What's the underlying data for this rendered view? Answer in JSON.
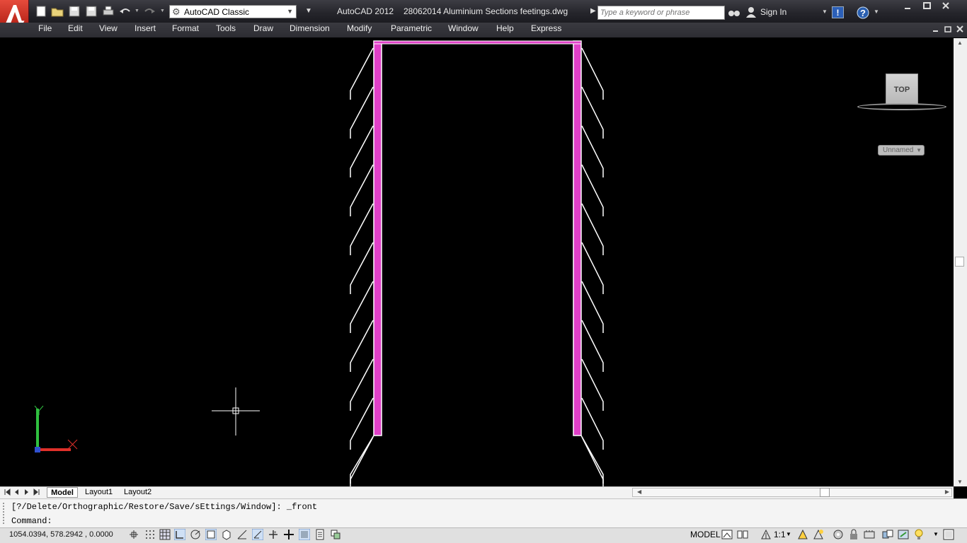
{
  "titlebar": {
    "workspace": "AutoCAD Classic",
    "app_name": "AutoCAD 2012",
    "file_name": "28062014 Aluminium Sections feetings.dwg",
    "search_placeholder": "Type a keyword or phrase",
    "sign_in": "Sign In"
  },
  "menu": [
    "File",
    "Edit",
    "View",
    "Insert",
    "Format",
    "Tools",
    "Draw",
    "Dimension",
    "Modify",
    "Parametric",
    "Window",
    "Help",
    "Express"
  ],
  "viewcube": {
    "face": "TOP",
    "viewport_name": "Unnamed"
  },
  "layout_tabs": [
    "Model",
    "Layout1",
    "Layout2"
  ],
  "command": {
    "history": "[?/Delete/Orthographic/Restore/Save/sEttings/Window]: _front",
    "prompt": "Command:"
  },
  "status": {
    "coordinates": "1054.0394, 578.2942 , 0.0000",
    "space": "MODEL",
    "annotation_scale": "1:1"
  },
  "colors": {
    "section_fill": "#e040c8",
    "line_white": "#ffffff",
    "ucs_x": "#e0302a",
    "ucs_y": "#30c040"
  }
}
